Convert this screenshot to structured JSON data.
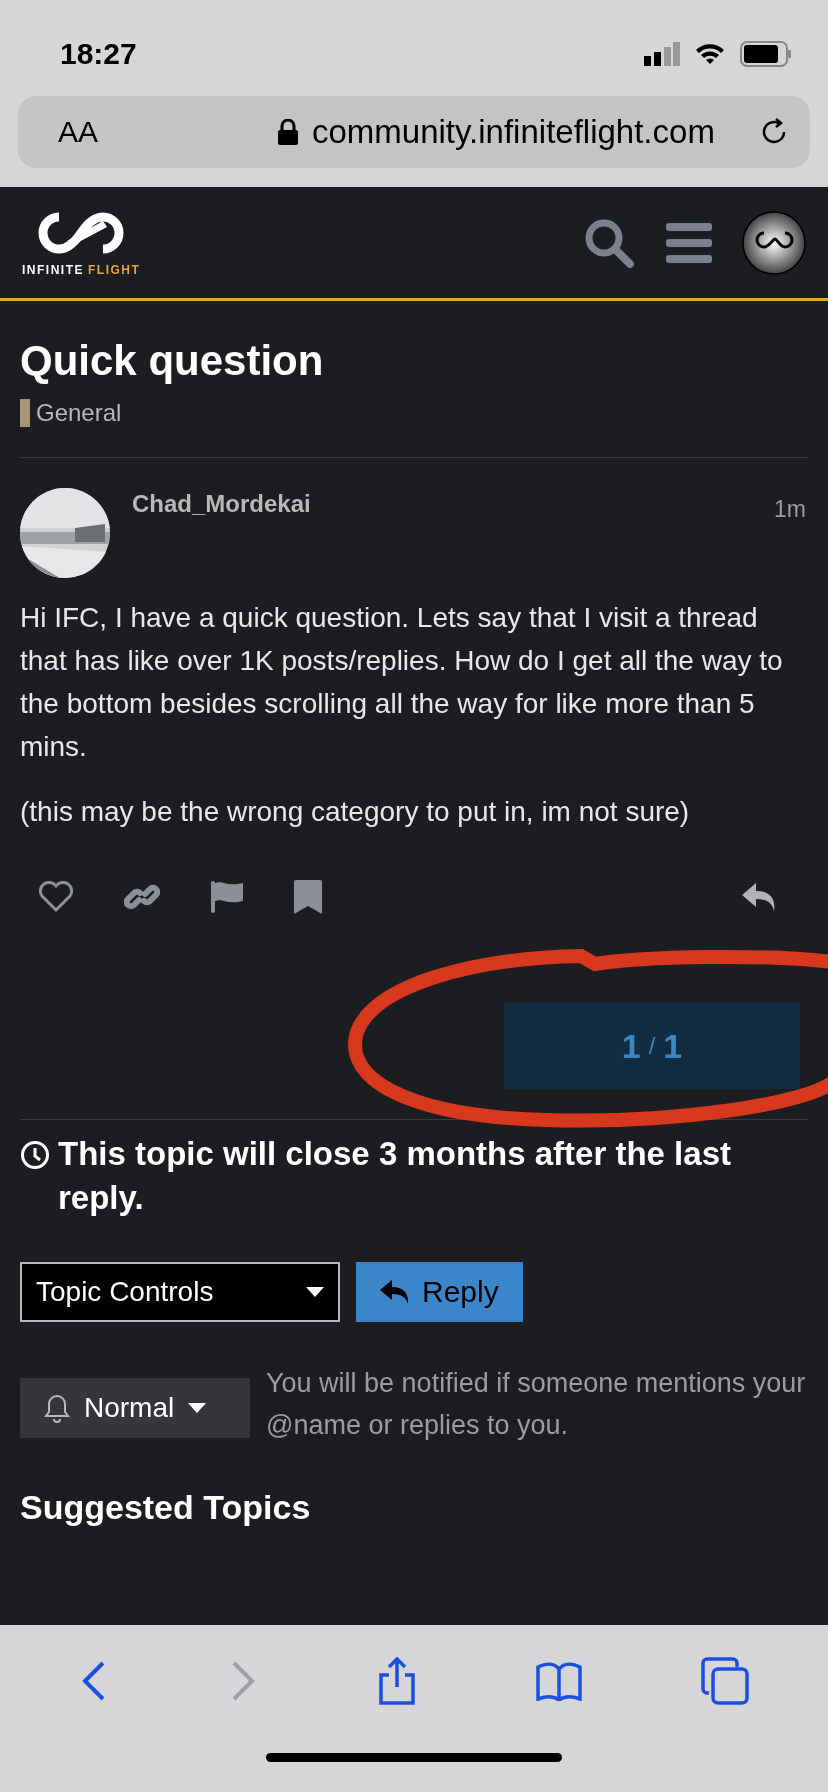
{
  "status_bar": {
    "time": "18:27"
  },
  "browser": {
    "text_size": "AA",
    "url": "community.infiniteflight.com"
  },
  "site_header": {
    "logo_words": [
      "INFINITE",
      "FLIGHT"
    ]
  },
  "topic": {
    "title": "Quick question",
    "category": "General"
  },
  "post": {
    "author": "Chad_Mordekai",
    "time": "1m",
    "paragraphs": [
      "Hi IFC, I have a quick question. Lets say that I visit a thread that has like over 1K posts/replies. How do I get all the way to the bottom besides scrolling all the way for like more than 5 mins.",
      "(this may be the wrong category to put in, im not sure)"
    ]
  },
  "progress": {
    "current": "1",
    "separator": "/",
    "total": "1"
  },
  "notice": "This topic will close 3 months after the last reply.",
  "controls": {
    "topic_controls": "Topic Controls",
    "reply": "Reply"
  },
  "notification": {
    "level": "Normal",
    "description": "You will be notified if someone mentions your @name or replies to you."
  },
  "suggested_heading": "Suggested Topics",
  "toolbar": {
    "back_disabled": false,
    "forward_disabled": true
  }
}
